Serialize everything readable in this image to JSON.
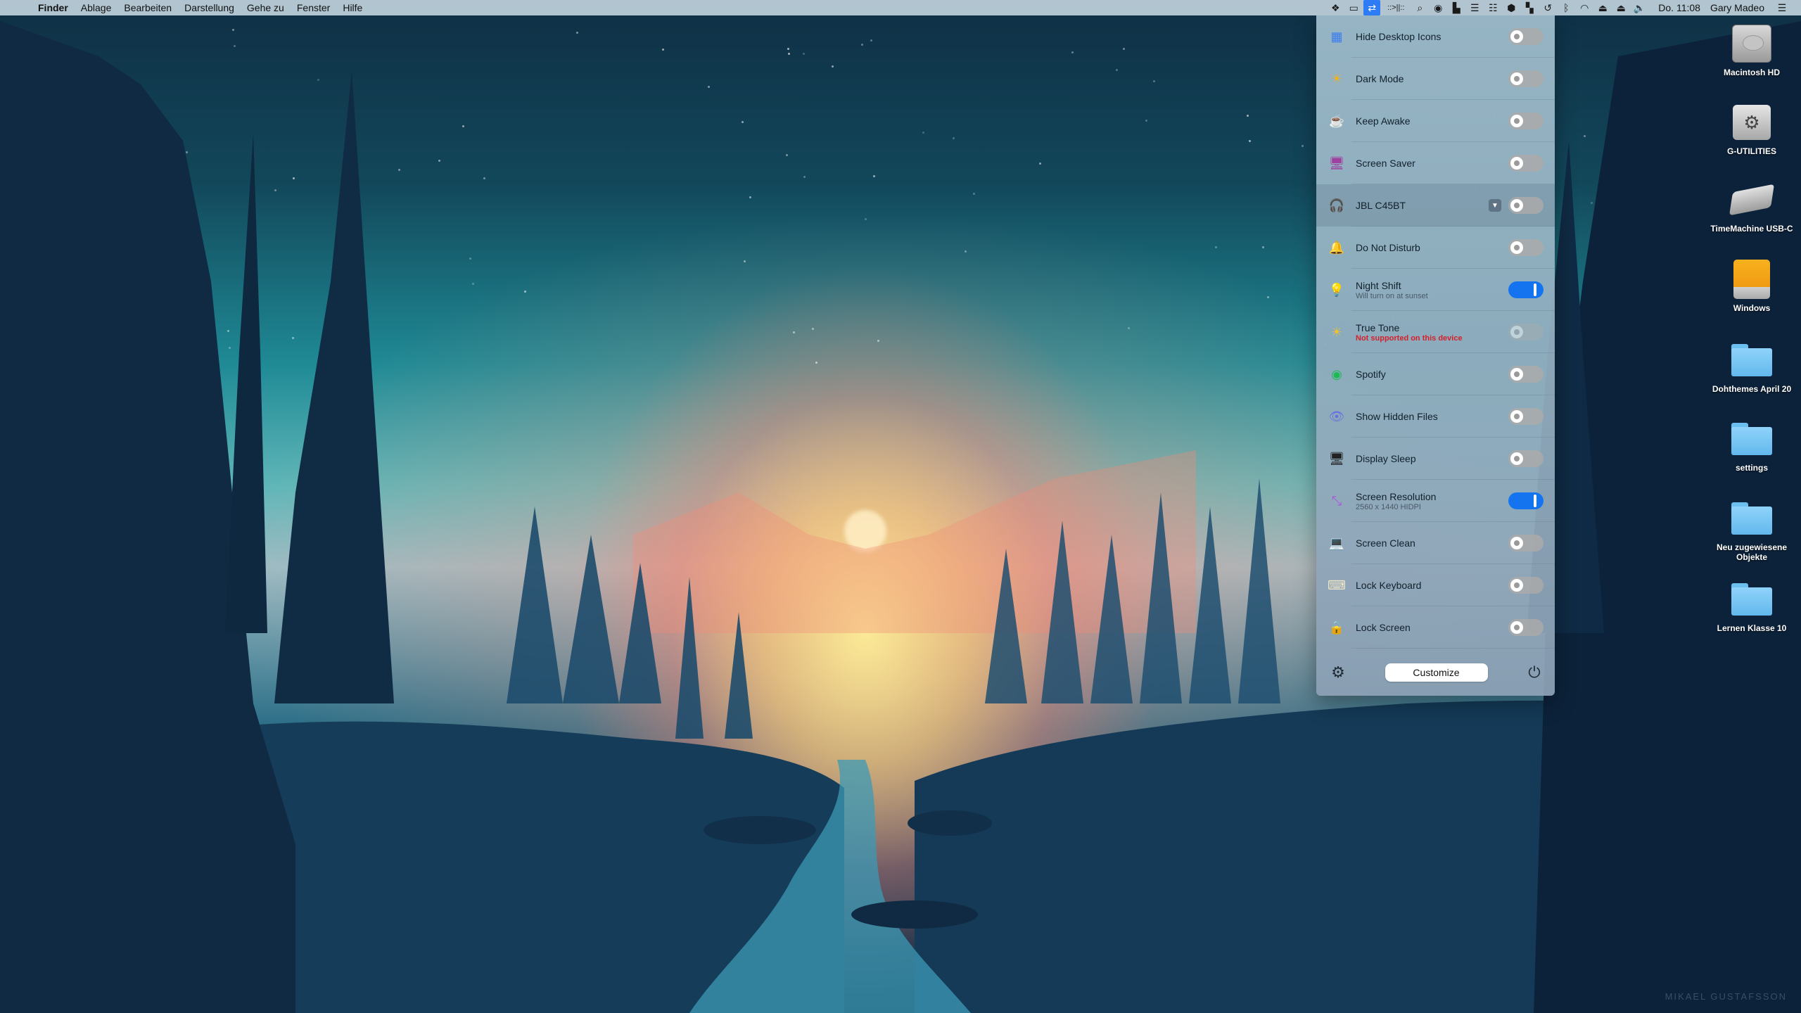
{
  "menubar": {
    "apple_icon": "",
    "app_name": "Finder",
    "menus": [
      "Ablage",
      "Bearbeiten",
      "Darstellung",
      "Gehe zu",
      "Fenster",
      "Hilfe"
    ],
    "status_icons": [
      {
        "name": "dropbox-icon",
        "glyph": "❖"
      },
      {
        "name": "window-icon",
        "glyph": "▭"
      },
      {
        "name": "one-switch-icon",
        "glyph": "⇄",
        "active": true
      },
      {
        "name": "bartender-icon",
        "glyph": "::>||::"
      },
      {
        "name": "spotlight-icon",
        "glyph": "⌕"
      },
      {
        "name": "siri-icon",
        "glyph": "◉"
      },
      {
        "name": "display-icon",
        "glyph": "▙"
      },
      {
        "name": "stack-icon",
        "glyph": "☰"
      },
      {
        "name": "grid-stack-icon",
        "glyph": "☷"
      },
      {
        "name": "shield-icon",
        "glyph": "⬢"
      },
      {
        "name": "layout-icon",
        "glyph": "▚"
      },
      {
        "name": "time-machine-icon",
        "glyph": "↺"
      },
      {
        "name": "bluetooth-icon",
        "glyph": "ᛒ"
      },
      {
        "name": "wifi-icon",
        "glyph": "◠"
      },
      {
        "name": "airplay-icon",
        "glyph": "⏏"
      },
      {
        "name": "eject-icon",
        "glyph": "⏏"
      },
      {
        "name": "volume-icon",
        "glyph": "🔈"
      }
    ],
    "clock": "Do. 11:08",
    "user": "Gary Madeo",
    "list_icon": "☰"
  },
  "panel": {
    "items": [
      {
        "label": "Hide Desktop Icons",
        "icon": "grid-icon",
        "glyph": "▦",
        "icon_color": "#3b7cf0",
        "on": false
      },
      {
        "label": "Dark Mode",
        "icon": "sun-icon",
        "glyph": "☀",
        "icon_color": "#f2b01e",
        "on": false
      },
      {
        "label": "Keep Awake",
        "icon": "coffee-cup-icon",
        "glyph": "☕",
        "icon_color": "#f4f4f4",
        "on": false
      },
      {
        "label": "Screen Saver",
        "icon": "screen-saver-icon",
        "glyph": "🖥",
        "icon_color": "#a040a0",
        "on": false
      },
      {
        "label": "JBL C45BT",
        "icon": "headphones-icon",
        "glyph": "🎧",
        "icon_color": "#f08a20",
        "on": false,
        "dropdown": true,
        "highlighted": true
      },
      {
        "label": "Do Not Disturb",
        "icon": "bell-icon",
        "glyph": "🔔",
        "icon_color": "#e0e0e0",
        "on": false
      },
      {
        "label": "Night Shift",
        "sub": "Will turn on at sunset",
        "icon": "lamp-icon",
        "glyph": "💡",
        "icon_color": "#f0d070",
        "on": true
      },
      {
        "label": "True Tone",
        "sub": "Not supported on this device",
        "sub_warn": true,
        "icon": "true-tone-sun-icon",
        "glyph": "☀",
        "icon_color": "#f2c030",
        "on": false,
        "disabled": true
      },
      {
        "label": "Spotify",
        "icon": "spotify-icon",
        "glyph": "◉",
        "icon_color": "#1db954",
        "on": false
      },
      {
        "label": "Show Hidden Files",
        "icon": "hidden-files-icon",
        "glyph": "👁",
        "icon_color": "#6a70e0",
        "on": false
      },
      {
        "label": "Display Sleep",
        "icon": "display-sleep-icon",
        "glyph": "🖥",
        "icon_color": "#222222",
        "on": false
      },
      {
        "label": "Screen Resolution",
        "sub": "2560 x 1440 HIDPI",
        "icon": "screen-resolution-icon",
        "glyph": "⤡",
        "icon_color": "#b050e0",
        "on": true
      },
      {
        "label": "Screen Clean",
        "icon": "screen-clean-icon",
        "glyph": "💻",
        "icon_color": "#333333",
        "on": false
      },
      {
        "label": "Lock Keyboard",
        "icon": "lock-keyboard-icon",
        "glyph": "⌨",
        "icon_color": "#f0e6c8",
        "on": false
      },
      {
        "label": "Lock Screen",
        "icon": "lock-screen-icon",
        "glyph": "🔒",
        "icon_color": "#e060b0",
        "on": false
      }
    ],
    "footer": {
      "settings_glyph": "⚙",
      "customize_label": "Customize",
      "power_glyph": "⏻"
    }
  },
  "desktop": {
    "icons": [
      {
        "name": "Macintosh HD",
        "type": "hd"
      },
      {
        "name": "G-UTILITIES",
        "type": "gutil"
      },
      {
        "name": "TimeMachine USB-C",
        "type": "ext"
      },
      {
        "name": "Windows",
        "type": "win"
      },
      {
        "name": "Dohthemes April 20",
        "type": "folder"
      },
      {
        "name": "settings",
        "type": "folder"
      },
      {
        "name": "Neu zugewiesene Objekte",
        "type": "folder"
      },
      {
        "name": "Lernen Klasse 10",
        "type": "folder"
      }
    ],
    "watermark": "MIKAEL GUSTAFSSON"
  }
}
